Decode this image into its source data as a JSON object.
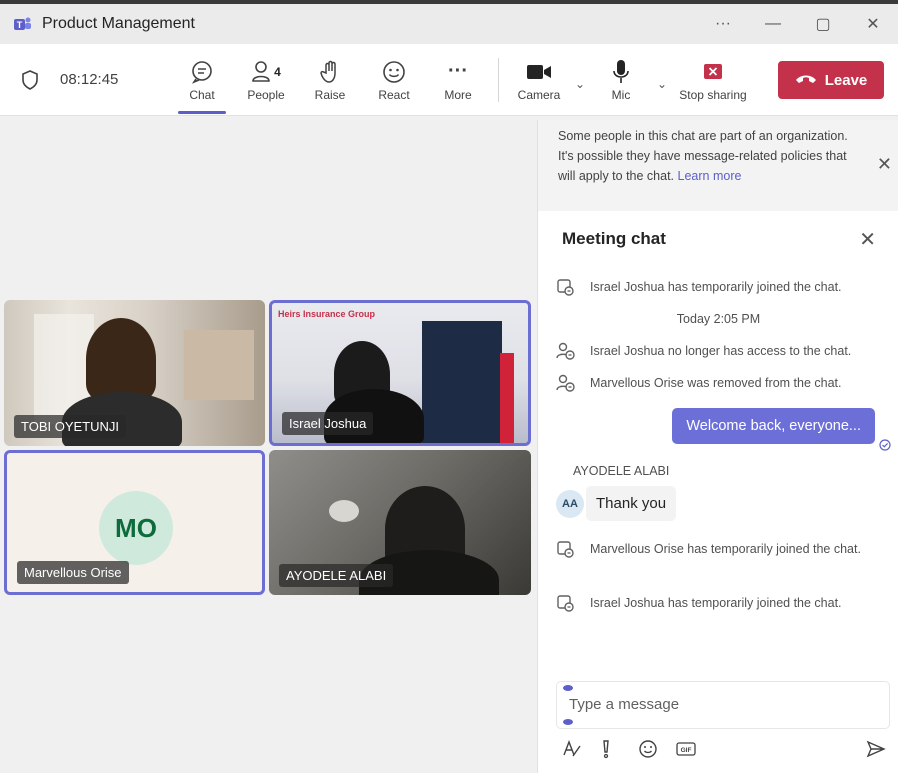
{
  "window": {
    "title": "Product Management",
    "more_label": "···",
    "minimize": "—",
    "maximize": "▢",
    "close": "✕"
  },
  "toolbar": {
    "timer": "08:12:45",
    "chat_label": "Chat",
    "people_label": "People",
    "people_count": "4",
    "raise_label": "Raise",
    "react_label": "React",
    "more_label": "More",
    "more_glyph": "···",
    "camera_label": "Camera",
    "mic_label": "Mic",
    "stop_sharing_label": "Stop sharing",
    "leave_label": "Leave",
    "caret": "⌄"
  },
  "stage": {
    "tiles": [
      {
        "name": "TOBI OYETUNJI"
      },
      {
        "name": "Israel Joshua",
        "logo": "Heirs Insurance Group"
      },
      {
        "name": "Marvellous Orise",
        "initials": "MO"
      },
      {
        "name": "AYODELE ALABI"
      }
    ]
  },
  "chat": {
    "notice_text": "Some people in this chat are part of an organization. It's possible they have message-related policies that will apply to the chat.",
    "notice_link": "Learn more",
    "title": "Meeting chat",
    "close_glyph": "✕",
    "messages": {
      "sys1": "Israel Joshua has temporarily joined the chat.",
      "timestamp": "Today 2:05 PM",
      "sys2": "Israel Joshua no longer has access to the chat.",
      "sys3": "Marvellous Orise was removed from the chat.",
      "me": "Welcome back, everyone...",
      "sender": "AYODELE ALABI",
      "sender_initials": "AA",
      "them": "Thank you",
      "sys4": "Marvellous Orise has temporarily joined the chat.",
      "sys5": "Israel Joshua has temporarily joined the chat."
    },
    "composer_placeholder": "Type a message"
  },
  "colors": {
    "accent": "#5b5fc7",
    "leave": "#c4314b",
    "bubble_me": "#6d6fd8"
  }
}
